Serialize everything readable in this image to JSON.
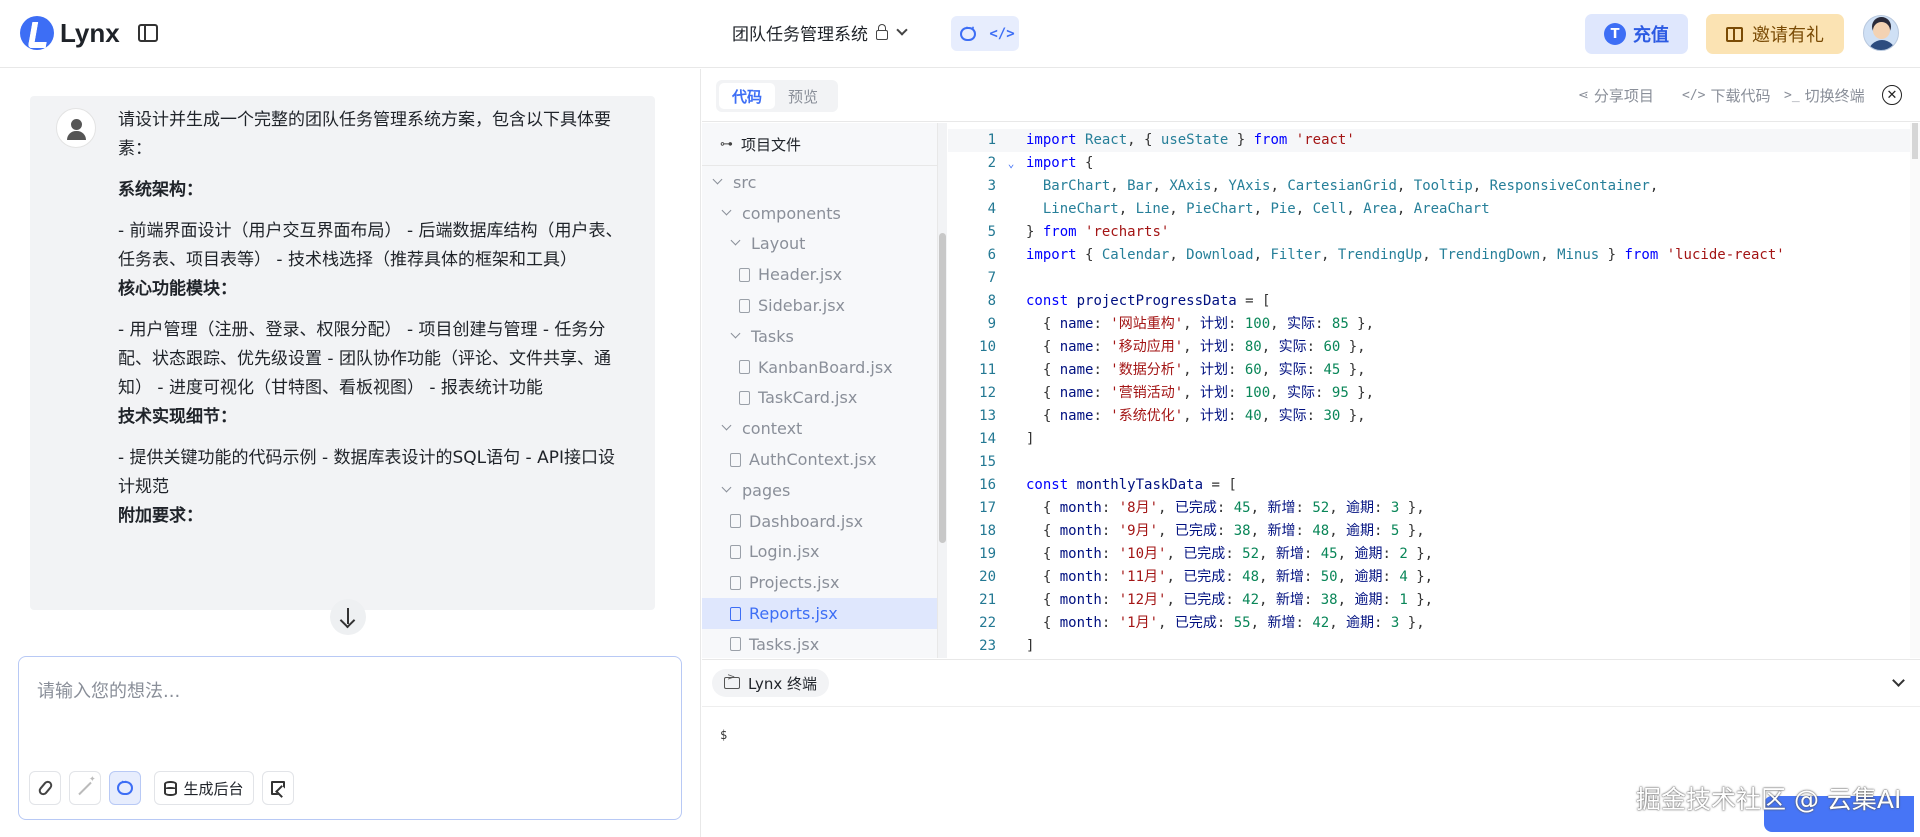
{
  "app": {
    "logo_text": "Lynx",
    "project_title": "团队任务管理系统",
    "brand_color": "#3d6ef5"
  },
  "header": {
    "recharge_label": "充值",
    "recharge_coin": "T",
    "invite_label": "邀请有礼",
    "mode_code_glyph": "</>"
  },
  "chat": {
    "message": {
      "intro": "请设计并生成一个完整的团队任务管理系统方案，包含以下具体要素：",
      "section1_title": "系统架构：",
      "section1_body": "- 前端界面设计（用户交互界面布局） - 后端数据库结构（用户表、任务表、项目表等） - 技术栈选择（推荐具体的框架和工具）",
      "section2_title": "核心功能模块：",
      "section2_body": "- 用户管理（注册、登录、权限分配） - 项目创建与管理 - 任务分配、状态跟踪、优先级设置 - 团队协作功能（评论、文件共享、通知） - 进度可视化（甘特图、看板视图） - 报表统计功能",
      "section3_title": "技术实现细节：",
      "section3_body": "- 提供关键功能的代码示例 - 数据库表设计的SQL语句 - API接口设计规范",
      "section4_title": "附加要求："
    },
    "input_placeholder": "请输入您的想法...",
    "generate_backend_label": "生成后台"
  },
  "workspace": {
    "tabs": [
      {
        "label": "代码",
        "active": true
      },
      {
        "label": "预览",
        "active": false
      }
    ],
    "actions": {
      "share": "分享项目",
      "download": "下载代码",
      "terminal_toggle": "切换终端",
      "close_glyph": "✕"
    },
    "file_tree": {
      "header": "项目文件",
      "items": [
        {
          "label": "src",
          "type": "folder",
          "depth": 0
        },
        {
          "label": "components",
          "type": "folder",
          "depth": 1
        },
        {
          "label": "Layout",
          "type": "folder",
          "depth": 2
        },
        {
          "label": "Header.jsx",
          "type": "file",
          "depth": 3
        },
        {
          "label": "Sidebar.jsx",
          "type": "file",
          "depth": 3
        },
        {
          "label": "Tasks",
          "type": "folder",
          "depth": 2
        },
        {
          "label": "KanbanBoard.jsx",
          "type": "file",
          "depth": 3
        },
        {
          "label": "TaskCard.jsx",
          "type": "file",
          "depth": 3
        },
        {
          "label": "context",
          "type": "folder",
          "depth": 1
        },
        {
          "label": "AuthContext.jsx",
          "type": "file",
          "depth": 2
        },
        {
          "label": "pages",
          "type": "folder",
          "depth": 1
        },
        {
          "label": "Dashboard.jsx",
          "type": "file",
          "depth": 2
        },
        {
          "label": "Login.jsx",
          "type": "file",
          "depth": 2
        },
        {
          "label": "Projects.jsx",
          "type": "file",
          "depth": 2
        },
        {
          "label": "Reports.jsx",
          "type": "file",
          "depth": 2,
          "selected": true
        },
        {
          "label": "Tasks.jsx",
          "type": "file",
          "depth": 2
        }
      ]
    },
    "code_lines": [
      "import React, { useState } from 'react'",
      "import {",
      "  BarChart, Bar, XAxis, YAxis, CartesianGrid, Tooltip, ResponsiveContainer,",
      "  LineChart, Line, PieChart, Pie, Cell, Area, AreaChart",
      "} from 'recharts'",
      "import { Calendar, Download, Filter, TrendingUp, TrendingDown, Minus } from 'lucide-react'",
      "",
      "const projectProgressData = [",
      "  { name: '网站重构', 计划: 100, 实际: 85 },",
      "  { name: '移动应用', 计划: 80, 实际: 60 },",
      "  { name: '数据分析', 计划: 60, 实际: 45 },",
      "  { name: '营销活动', 计划: 100, 实际: 95 },",
      "  { name: '系统优化', 计划: 40, 实际: 30 },",
      "]",
      "",
      "const monthlyTaskData = [",
      "  { month: '8月', 已完成: 45, 新增: 52, 逾期: 3 },",
      "  { month: '9月', 已完成: 38, 新增: 48, 逾期: 5 },",
      "  { month: '10月', 已完成: 52, 新增: 45, 逾期: 2 },",
      "  { month: '11月', 已完成: 48, 新增: 50, 逾期: 4 },",
      "  { month: '12月', 已完成: 42, 新增: 38, 逾期: 1 },",
      "  { month: '1月', 已完成: 55, 新增: 42, 逾期: 3 },",
      "]"
    ],
    "folded_line": 2,
    "current_line": 1,
    "terminal": {
      "tab_label": "Lynx 终端",
      "prompt": "$"
    }
  },
  "watermark": "掘金技术社区 @ 云集AI"
}
